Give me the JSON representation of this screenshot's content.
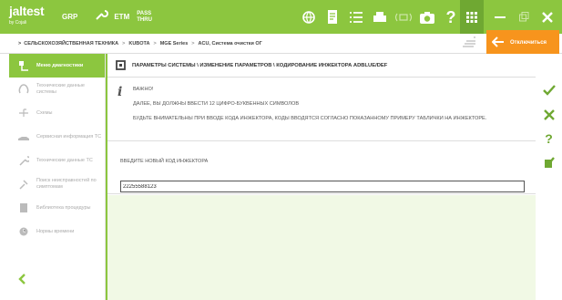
{
  "topbar": {
    "logo": "jaltest",
    "logo_sub": "by Cojali",
    "tab_grp": "GRP",
    "tab_etm": "ETM",
    "pass_line1": "PASS",
    "pass_line2": "THRU",
    "icons": [
      "globe-icon",
      "document-icon",
      "list-icon",
      "printer-icon",
      "signal-icon",
      "camera-icon",
      "help-icon",
      "grid-icon"
    ],
    "window_controls": [
      "minimize-icon",
      "restore-icon",
      "close-icon"
    ]
  },
  "breadcrumb": {
    "items": [
      "СЕЛЬСКОХОЗЯЙСТВЕННАЯ ТЕХНИКА",
      "KUBOTA",
      "MGE Series",
      "ACU, Система очистки ОГ"
    ],
    "separator": ">",
    "back_label": "Отключиться"
  },
  "sidebar": {
    "items": [
      {
        "label": "Меню диагностики",
        "icon": "diagnostic-menu-icon",
        "active": true
      },
      {
        "label": "Технические данные системы",
        "icon": "system-data-icon",
        "active": false
      },
      {
        "label": "Схемы",
        "icon": "schemes-icon",
        "active": false
      },
      {
        "label": "Сервисная информация ТС",
        "icon": "service-info-icon",
        "active": false
      },
      {
        "label": "Технические данные ТС",
        "icon": "vehicle-data-icon",
        "active": false
      },
      {
        "label": "Поиск неисправностей по симптомам",
        "icon": "troubleshooting-icon",
        "active": false
      },
      {
        "label": "Библиотека процедуры",
        "icon": "library-icon",
        "active": false
      },
      {
        "label": "Нормы времени",
        "icon": "time-norms-icon",
        "active": false
      }
    ],
    "collapse_icon": "chevron-left-icon"
  },
  "main": {
    "header": "ПАРАМЕТРЫ СИСТЕМЫ \\ ИЗМЕНЕНИЕ ПАРАМЕТРОВ \\ КОДИРОВАНИЕ ИНЖЕКТОРА ADBLUE/DEF",
    "info": {
      "title": "ВАЖНО!",
      "line1": "ДАЛЕЕ, ВЫ ДОЛЖНЫ ВВЕСТИ 12 ЦИФРО-БУКВЕННЫХ СИМВОЛОВ",
      "line2": "БУДЬТЕ ВНИМАТЕЛЬНЫ ПРИ ВВОДЕ КОДА ИНЖЕКТОРА, КОДЫ ВВОДЯТСЯ СОГЛАСНО ПОКАЗАННОМУ ПРИМЕРУ ТАБЛИЧКИ НА ИНЖЕКТОРЕ."
    },
    "input_label": "ВВЕДИТЕ НОВЫЙ КОД ИНЖЕКТОРА",
    "input_value": "22255588123"
  },
  "rightbar": {
    "actions": [
      "accept-icon",
      "cancel-icon",
      "help-icon",
      "document-edit-icon"
    ]
  },
  "colors": {
    "brand_green": "#8cc63f",
    "accent_orange": "#f7941d",
    "light_green_bg": "#f1f9e5",
    "cancel_green": "#6fa832"
  }
}
